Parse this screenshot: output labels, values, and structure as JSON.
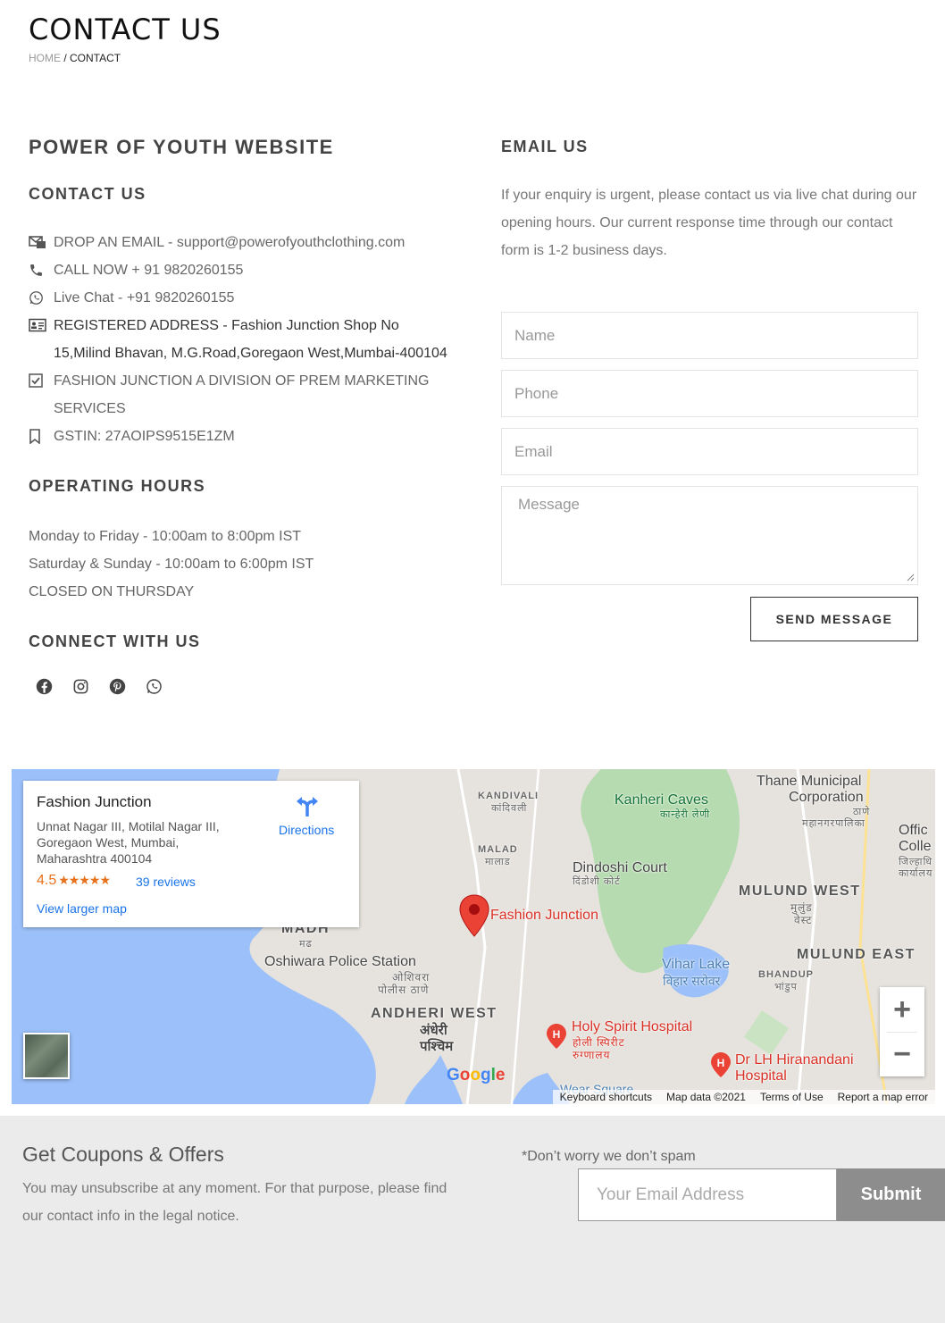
{
  "header": {
    "title": "CONTACT US",
    "breadcrumb_home": "HOME",
    "breadcrumb_sep": " / ",
    "breadcrumb_current": "CONTACT"
  },
  "left": {
    "site_title": "POWER OF YOUTH WEBSITE",
    "contact_heading": "CONTACT US",
    "contact_items": [
      {
        "icon": "email-icon",
        "text": "DROP AN EMAIL - support@powerofyouthclothing.com"
      },
      {
        "icon": "phone-icon",
        "text": "CALL NOW + 91 9820260155"
      },
      {
        "icon": "whatsapp-icon",
        "text": "Live Chat - +91 9820260155"
      },
      {
        "icon": "id-card-icon",
        "text": "REGISTERED ADDRESS - Fashion Junction Shop No 15,Milind Bhavan, M.G.Road,Goregaon West,Mumbai-400104"
      },
      {
        "icon": "checkbox-icon",
        "text": "FASHION JUNCTION A DIVISION OF PREM MARKETING SERVICES"
      },
      {
        "icon": "bookmark-icon",
        "text": "GSTIN: 27AOIPS9515E1ZM"
      }
    ],
    "hours_heading": "OPERATING HOURS",
    "hours": [
      "Monday to Friday - 10:00am to 8:00pm IST",
      "Saturday & Sunday - 10:00am to 6:00pm IST",
      "CLOSED ON THURSDAY"
    ],
    "connect_heading": "CONNECT WITH US",
    "social_icons": [
      "facebook-icon",
      "instagram-icon",
      "pinterest-icon",
      "whatsapp-icon"
    ]
  },
  "right": {
    "email_heading": "EMAIL US",
    "email_text": "If your enquiry is urgent, please contact us via live chat during our opening hours. Our current response time through our contact form is 1-2 business days.",
    "form": {
      "name_placeholder": "Name",
      "phone_placeholder": "Phone",
      "email_placeholder": "Email",
      "message_placeholder": "Message",
      "send_label": "SEND MESSAGE"
    }
  },
  "map": {
    "place_name": "Fashion Junction",
    "address": "Unnat Nagar III, Motilal Nagar III, Goregaon West, Mumbai, Maharashtra 400104",
    "rating": "4.5",
    "stars": "★★★★★",
    "reviews": "39 reviews",
    "larger_map": "View larger map",
    "directions": "Directions",
    "labels": {
      "kandivali": "KANDIVALI",
      "kandivali_hi": "कांदिवली",
      "malad": "MALAD",
      "malad_hi": "मालाड",
      "madh": "MADH",
      "madh_hi": "मढ",
      "kanheri": "Kanheri Caves",
      "kanheri_hi": "कान्हेरी लेणी",
      "thane1": "Thane Municipal",
      "thane2": "Corporation",
      "thane_hi1": "ठाणे",
      "thane_hi2": "महानगरपालिका",
      "office1": "Offic",
      "office2": "Colle",
      "office_hi1": "जिल्हाधि",
      "office_hi2": "कार्यालय",
      "dindoshi": "Dindoshi Court",
      "dindoshi_hi": "दिंडोशी कोर्ट",
      "mulund_w": "MULUND WEST",
      "mulund_w_hi1": "मुलुंड",
      "mulund_w_hi2": "वेस्ट",
      "mulund_e": "MULUND EAST",
      "bhandup": "BHANDUP",
      "bhandup_hi": "भांडुप",
      "pin": "Fashion Junction",
      "oshiwara": "Oshiwara Police Station",
      "oshiwara_hi1": "ओशिवरा",
      "oshiwara_hi2": "पोलीस ठाणे",
      "vihar": "Vihar Lake",
      "vihar_hi": "विहार सरोवर",
      "andheri": "ANDHERI WEST",
      "andheri_hi1": "अंधेरी",
      "andheri_hi2": "पश्चिम",
      "holy1": "Holy Spirit Hospital",
      "holy_hi1": "होली स्पिरीट",
      "holy_hi2": "रुग्णालय",
      "hiranandani1": "Dr LH Hiranandani",
      "hiranandani2": "Hospital",
      "wear": "Wear Square"
    },
    "google": "Google",
    "footer": {
      "shortcuts": "Keyboard shortcuts",
      "data": "Map data ©2021",
      "terms": "Terms of Use",
      "report": "Report a map error"
    },
    "colors": {
      "water": "#9cc0f9",
      "park": "#b6dbb0",
      "pin": "#ea4335"
    }
  },
  "footer": {
    "title": "Get Coupons & Offers",
    "text": "You may unsubscribe at any moment. For that purpose, please find our contact info in the legal notice.",
    "spam_note": "*Don’t worry we don’t spam",
    "email_placeholder": "Your Email Address",
    "submit_label": "Submit"
  }
}
